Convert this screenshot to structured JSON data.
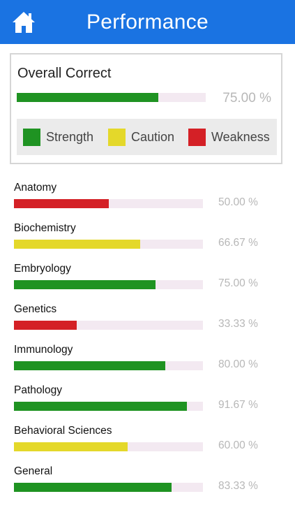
{
  "header": {
    "title": "Performance",
    "home_icon": "home-icon"
  },
  "overall": {
    "title": "Overall Correct",
    "percent_text": "75.00 %",
    "fraction": 0.75,
    "level": "strength"
  },
  "legend": [
    {
      "label": "Strength",
      "color": "#1f9322",
      "key": "strength"
    },
    {
      "label": "Caution",
      "color": "#e4d82a",
      "key": "caution"
    },
    {
      "label": "Weakness",
      "color": "#d42026",
      "key": "weakness"
    }
  ],
  "colors": {
    "strength": "#1f9322",
    "caution": "#e4d82a",
    "weakness": "#d42026",
    "track": "#f3e9f1",
    "header": "#1a73e2"
  },
  "subjects": [
    {
      "name": "Anatomy",
      "percent_text": "50.00 %",
      "fraction": 0.5,
      "level": "weakness"
    },
    {
      "name": "Biochemistry",
      "percent_text": "66.67 %",
      "fraction": 0.6667,
      "level": "caution"
    },
    {
      "name": "Embryology",
      "percent_text": "75.00 %",
      "fraction": 0.75,
      "level": "strength"
    },
    {
      "name": "Genetics",
      "percent_text": "33.33 %",
      "fraction": 0.3333,
      "level": "weakness"
    },
    {
      "name": "Immunology",
      "percent_text": "80.00 %",
      "fraction": 0.8,
      "level": "strength"
    },
    {
      "name": "Pathology",
      "percent_text": "91.67 %",
      "fraction": 0.9167,
      "level": "strength"
    },
    {
      "name": "Behavioral Sciences",
      "percent_text": "60.00 %",
      "fraction": 0.6,
      "level": "caution"
    },
    {
      "name": "General",
      "percent_text": "83.33 %",
      "fraction": 0.8333,
      "level": "strength"
    }
  ]
}
